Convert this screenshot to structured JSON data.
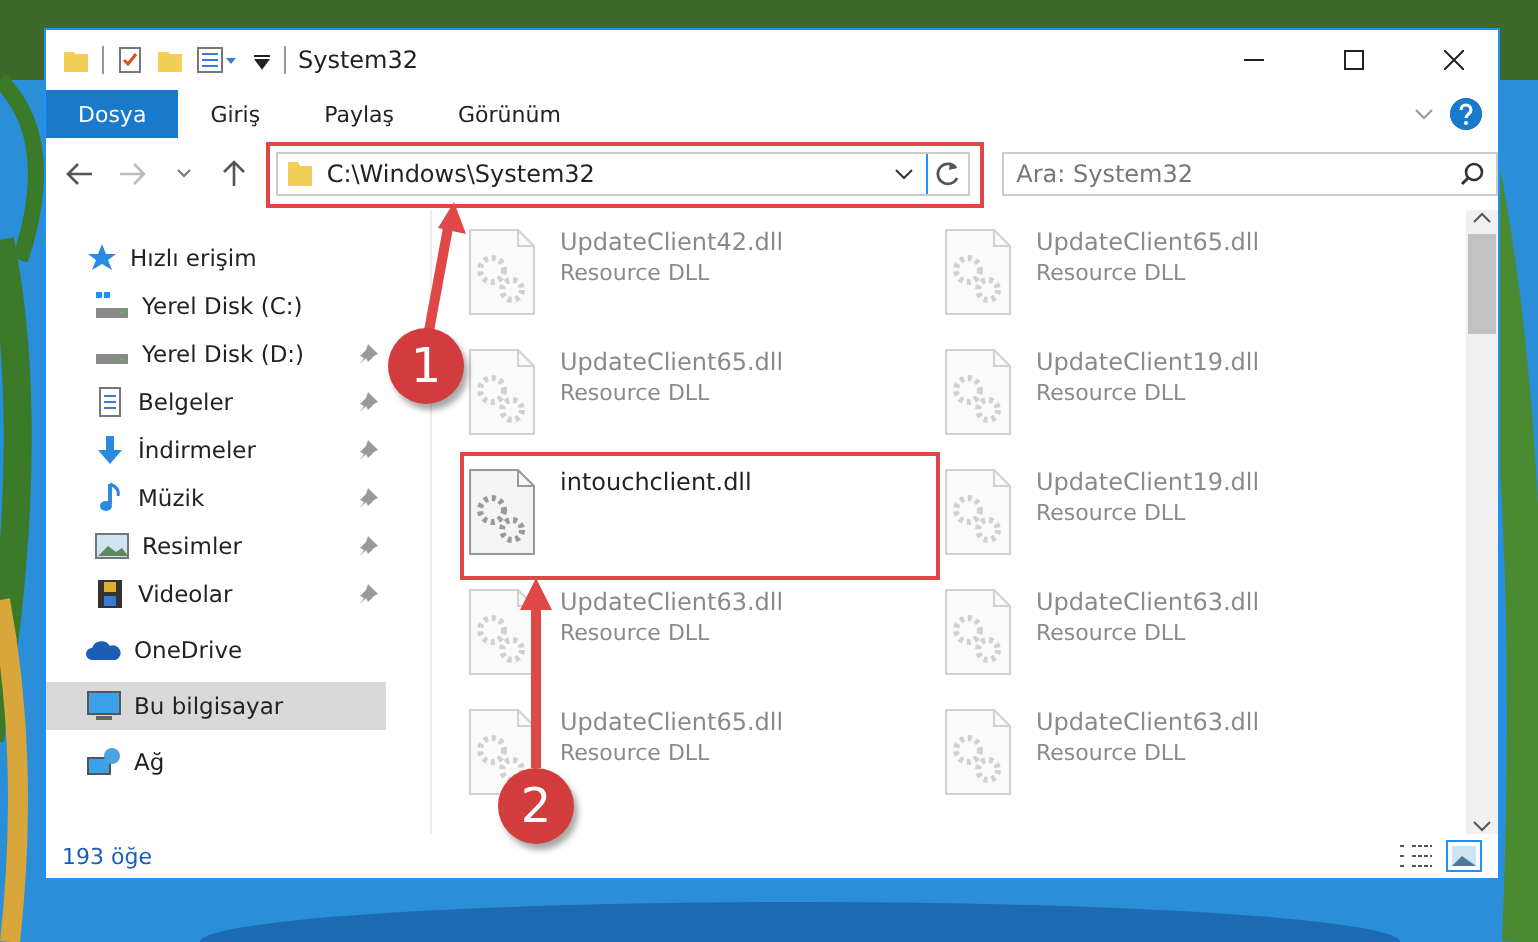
{
  "window": {
    "title": "System32"
  },
  "ribbon_tabs": [
    {
      "label": "Dosya",
      "selected": true
    },
    {
      "label": "Giriş",
      "selected": false
    },
    {
      "label": "Paylaş",
      "selected": false
    },
    {
      "label": "Görünüm",
      "selected": false
    }
  ],
  "address": {
    "value": "C:\\Windows\\System32"
  },
  "search": {
    "placeholder": "Ara: System32"
  },
  "sidebar": {
    "items": [
      {
        "label": "Hızlı erişim",
        "kind": "group",
        "pinned": false,
        "selected": false
      },
      {
        "label": "Yerel Disk (C:)",
        "kind": "item",
        "pinned": false,
        "selected": false
      },
      {
        "label": "Yerel Disk (D:)",
        "kind": "item",
        "pinned": true,
        "selected": false
      },
      {
        "label": "Belgeler",
        "kind": "item",
        "pinned": true,
        "selected": false
      },
      {
        "label": "İndirmeler",
        "kind": "item",
        "pinned": true,
        "selected": false
      },
      {
        "label": "Müzik",
        "kind": "item",
        "pinned": true,
        "selected": false
      },
      {
        "label": "Resimler",
        "kind": "item",
        "pinned": true,
        "selected": false
      },
      {
        "label": "Videolar",
        "kind": "item",
        "pinned": true,
        "selected": false
      },
      {
        "label": "OneDrive",
        "kind": "group",
        "pinned": false,
        "selected": false
      },
      {
        "label": "Bu bilgisayar",
        "kind": "group",
        "pinned": false,
        "selected": true
      },
      {
        "label": "Ağ",
        "kind": "group",
        "pinned": false,
        "selected": false
      }
    ]
  },
  "files": [
    {
      "name": "UpdateClient42.dll",
      "type": "Resource DLL",
      "kind": "faded"
    },
    {
      "name": "UpdateClient65.dll",
      "type": "Resource DLL",
      "kind": "faded"
    },
    {
      "name": "UpdateClient65.dll",
      "type": "Resource DLL",
      "kind": "faded"
    },
    {
      "name": "UpdateClient19.dll",
      "type": "Resource DLL",
      "kind": "faded"
    },
    {
      "name": "intouchclient.dll",
      "kind": "plain"
    },
    {
      "name": "UpdateClient19.dll",
      "type": "Resource DLL",
      "kind": "faded"
    },
    {
      "name": "UpdateClient63.dll",
      "type": "Resource DLL",
      "kind": "faded"
    },
    {
      "name": "UpdateClient63.dll",
      "type": "Resource DLL",
      "kind": "faded"
    },
    {
      "name": "UpdateClient65.dll",
      "type": "Resource DLL",
      "kind": "faded"
    },
    {
      "name": "UpdateClient63.dll",
      "type": "Resource DLL",
      "kind": "faded"
    }
  ],
  "status_bar": {
    "count": "193 öğe"
  },
  "annotations": [
    {
      "number": "1"
    },
    {
      "number": "2"
    }
  ]
}
